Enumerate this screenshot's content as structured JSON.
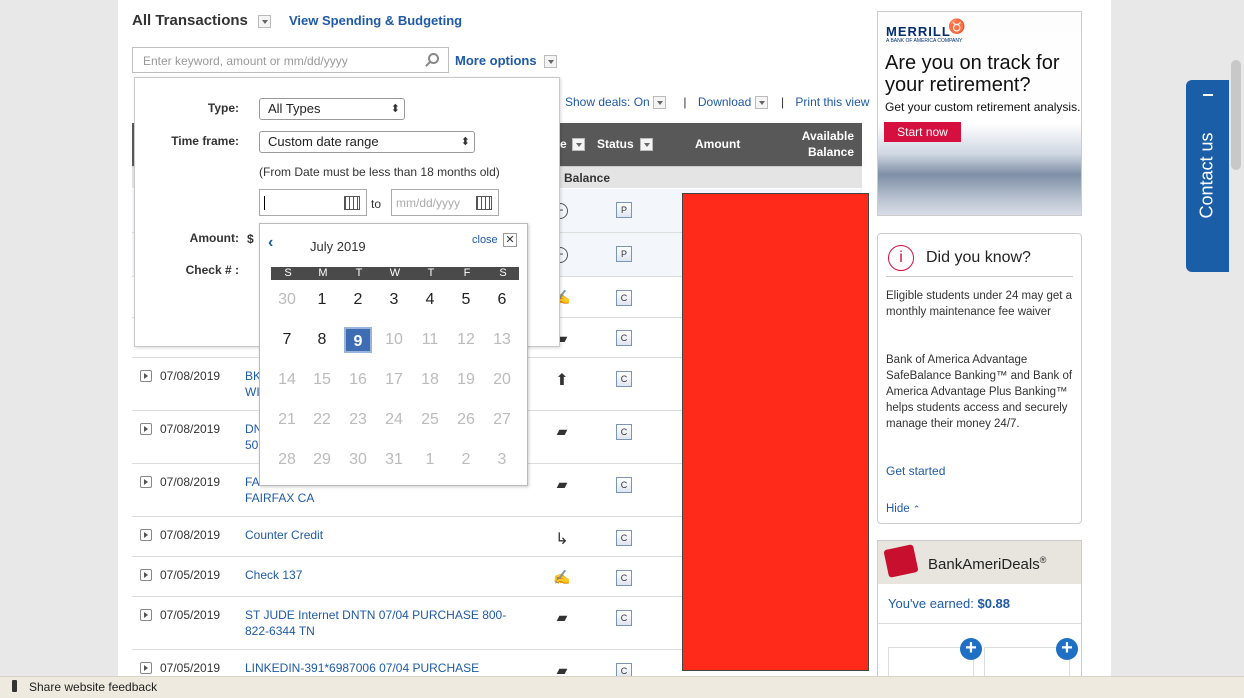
{
  "header": {
    "title": "All Transactions",
    "spending_link": "View Spending & Budgeting"
  },
  "search": {
    "placeholder": "Enter keyword, amount or mm/dd/yyyy",
    "more_options": "More options"
  },
  "toolbar": {
    "show_deals": "Show deals: On",
    "separator": "|",
    "download": "Download",
    "print": "Print this view"
  },
  "table": {
    "headers": {
      "type": "e",
      "status": "Status",
      "amount": "Amount",
      "available_balance_1": "Available",
      "available_balance_2": "Balance"
    },
    "subheader": "Balance",
    "rows": [
      {
        "date": "",
        "desc": "",
        "status": "P"
      },
      {
        "date": "",
        "desc": "",
        "status": "P"
      },
      {
        "date": "",
        "desc": "",
        "status": "C"
      },
      {
        "date": "",
        "desc": "",
        "status": "C"
      },
      {
        "date": "07/08/2019",
        "desc": "BK",
        "desc2": "WI",
        "status": "C"
      },
      {
        "date": "07/08/2019",
        "desc": "DN",
        "desc2": "50",
        "status": "C"
      },
      {
        "date": "07/08/2019",
        "desc": "FA",
        "desc2": "FAIRFAX CA",
        "status": "C"
      },
      {
        "date": "07/08/2019",
        "desc": "Counter Credit",
        "status": "C"
      },
      {
        "date": "07/05/2019",
        "desc": "Check 137",
        "status": "C"
      },
      {
        "date": "07/05/2019",
        "desc": "ST JUDE Internet DNTN 07/04 PURCHASE 800-822-6344 TN",
        "status": "C"
      },
      {
        "date": "07/05/2019",
        "desc": "LINKEDIN-391*6987006 07/04 PURCHASE",
        "status": "C"
      }
    ]
  },
  "filters": {
    "type_label": "Type:",
    "type_value": "All Types",
    "timeframe_label": "Time frame:",
    "timeframe_value": "Custom date range",
    "timeframe_note": "(From Date must be less than 18 months old)",
    "from_value": "",
    "to_label": "to",
    "to_placeholder": "mm/dd/yyyy",
    "amount_label": "Amount:",
    "amount_currency": "$",
    "check_label": "Check # :"
  },
  "calendar": {
    "month": "July 2019",
    "close": "close",
    "weekdays": [
      "S",
      "M",
      "T",
      "W",
      "T",
      "F",
      "S"
    ],
    "weeks": [
      [
        "30",
        "1",
        "2",
        "3",
        "4",
        "5",
        "6"
      ],
      [
        "7",
        "8",
        "9",
        "10",
        "11",
        "12",
        "13"
      ],
      [
        "14",
        "15",
        "16",
        "17",
        "18",
        "19",
        "20"
      ],
      [
        "21",
        "22",
        "23",
        "24",
        "25",
        "26",
        "27"
      ],
      [
        "28",
        "29",
        "30",
        "31",
        "1",
        "2",
        "3"
      ]
    ],
    "selected": "9"
  },
  "ad": {
    "brand": "MERRILL",
    "brand_sub": "A BANK OF AMERICA COMPANY",
    "headline_1": "Are you on track for",
    "headline_2": "your retirement?",
    "sub": "Get your custom retirement analysis.",
    "cta": "Start now"
  },
  "did_you_know": {
    "title": "Did you know?",
    "p1": "Eligible students under 24 may get a monthly maintenance fee waiver",
    "p2": "Bank of America Advantage SafeBalance Banking™ and Bank of America Advantage Plus Banking™ helps students access and securely manage their money 24/7.",
    "link": "Get started",
    "hide": "Hide"
  },
  "bankamerideals": {
    "title": "BankAmeriDeals",
    "reg": "®",
    "earned_label": "You've earned:",
    "earned_value": "$0.88"
  },
  "contact": {
    "label": "Contact us"
  },
  "feedback": {
    "label": "Share website feedback"
  },
  "colors": {
    "accent": "#1f5aa6",
    "redacted": "#ff2a1a",
    "header_gray": "#585858",
    "cta_red": "#d5103f"
  }
}
